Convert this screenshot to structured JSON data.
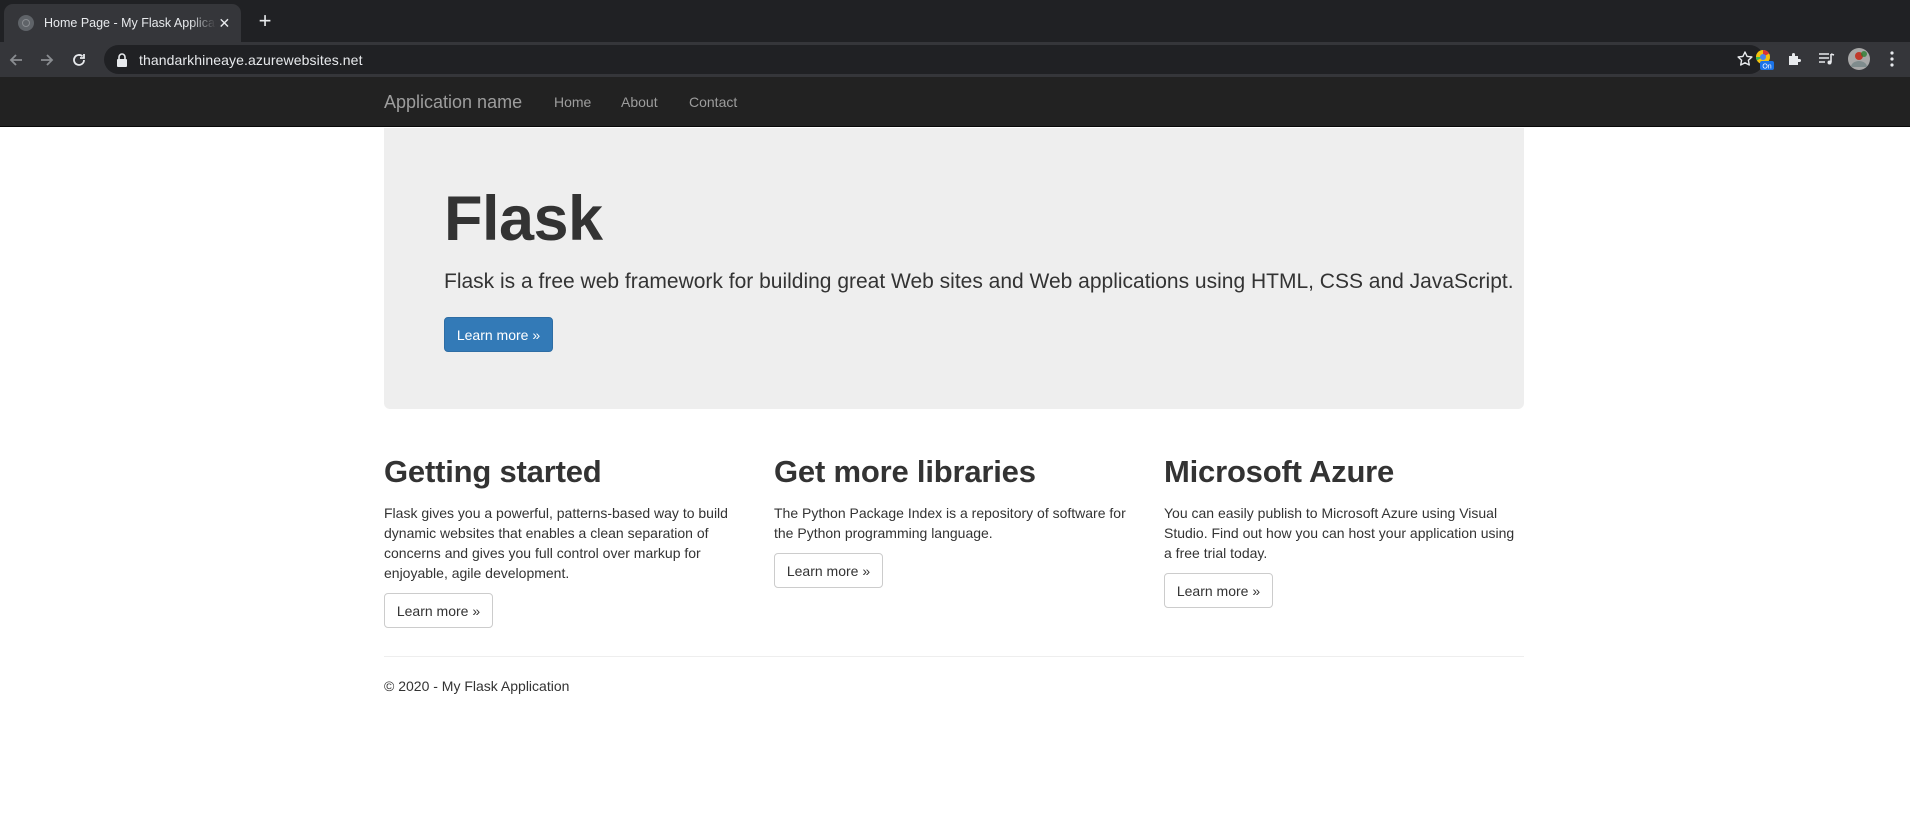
{
  "browser": {
    "tab_title": "Home Page - My Flask Application",
    "tab_close": "✕",
    "new_tab": "+",
    "url": "thandarkhineaye.azurewebsites.net",
    "extension_badge": "On"
  },
  "navbar": {
    "brand": "Application name",
    "links": [
      "Home",
      "About",
      "Contact"
    ]
  },
  "jumbotron": {
    "title": "Flask",
    "lead": "Flask is a free web framework for building great Web sites and Web applications using HTML, CSS and JavaScript.",
    "button": "Learn more »"
  },
  "columns": [
    {
      "title": "Getting started",
      "text": "Flask gives you a powerful, patterns-based way to build dynamic websites that enables a clean separation of concerns and gives you full control over markup for enjoyable, agile development.",
      "button": "Learn more »"
    },
    {
      "title": "Get more libraries",
      "text": "The Python Package Index is a repository of software for the Python programming language.",
      "button": "Learn more »"
    },
    {
      "title": "Microsoft Azure",
      "text": "You can easily publish to Microsoft Azure using Visual Studio. Find out how you can host your application using a free trial today.",
      "button": "Learn more »"
    }
  ],
  "footer": {
    "text": "© 2020 - My Flask Application"
  },
  "colors": {
    "chrome_bg": "#202124",
    "navbar_bg": "#222222",
    "jumbotron_bg": "#eeeeee",
    "primary": "#337ab7"
  },
  "icons": [
    "globe-icon",
    "close-icon",
    "plus-icon",
    "back-icon",
    "forward-icon",
    "reload-icon",
    "lock-icon",
    "star-icon",
    "extension-on-icon",
    "puzzle-icon",
    "media-icon",
    "avatar",
    "menu-icon"
  ]
}
